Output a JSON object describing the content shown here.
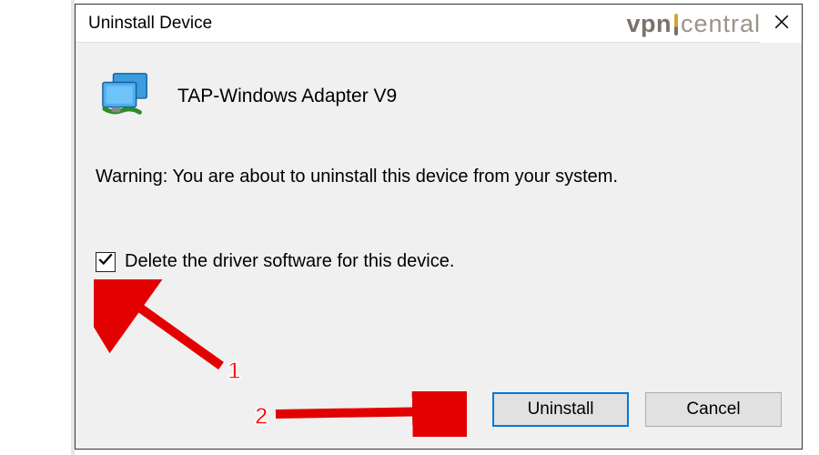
{
  "dialog": {
    "title": "Uninstall Device",
    "device_name": "TAP-Windows Adapter V9",
    "warning_text": "Warning: You are about to uninstall this device from your system.",
    "checkbox_label": "Delete the driver software for this device.",
    "checkbox_checked": true,
    "buttons": {
      "primary": "Uninstall",
      "secondary": "Cancel"
    },
    "close_label": "Close"
  },
  "watermark": {
    "part1": "vpn",
    "part2": "central"
  },
  "annotations": {
    "step1": "1",
    "step2": "2"
  }
}
